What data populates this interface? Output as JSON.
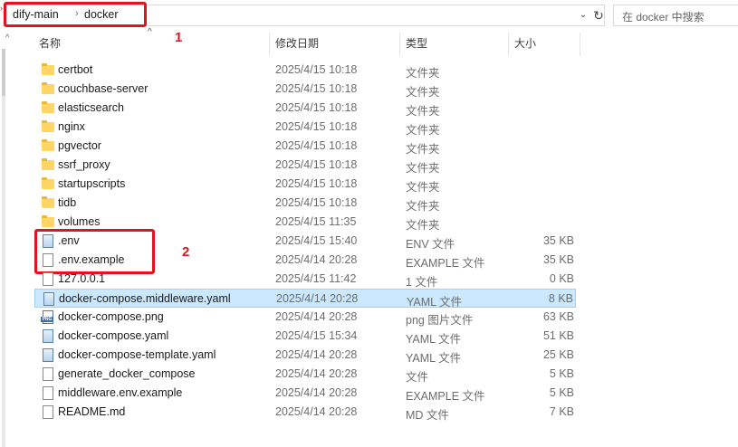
{
  "address": {
    "crumbs": [
      "dify-main",
      "docker"
    ],
    "search_placeholder": "在 docker 中搜索"
  },
  "annotations": {
    "box1_number": "1",
    "box2_number": "2"
  },
  "columns": {
    "name": "名称",
    "date": "修改日期",
    "type": "类型",
    "size": "大小"
  },
  "files": [
    {
      "name": "certbot",
      "date": "2025/4/15 10:18",
      "type": "文件夹",
      "size": "",
      "icon": "folder-icon"
    },
    {
      "name": "couchbase-server",
      "date": "2025/4/15 10:18",
      "type": "文件夹",
      "size": "",
      "icon": "folder-icon"
    },
    {
      "name": "elasticsearch",
      "date": "2025/4/15 10:18",
      "type": "文件夹",
      "size": "",
      "icon": "folder-icon"
    },
    {
      "name": "nginx",
      "date": "2025/4/15 10:18",
      "type": "文件夹",
      "size": "",
      "icon": "folder-icon"
    },
    {
      "name": "pgvector",
      "date": "2025/4/15 10:18",
      "type": "文件夹",
      "size": "",
      "icon": "folder-icon"
    },
    {
      "name": "ssrf_proxy",
      "date": "2025/4/15 10:18",
      "type": "文件夹",
      "size": "",
      "icon": "folder-icon"
    },
    {
      "name": "startupscripts",
      "date": "2025/4/15 10:18",
      "type": "文件夹",
      "size": "",
      "icon": "folder-icon"
    },
    {
      "name": "tidb",
      "date": "2025/4/15 10:18",
      "type": "文件夹",
      "size": "",
      "icon": "folder-icon"
    },
    {
      "name": "volumes",
      "date": "2025/4/15 11:35",
      "type": "文件夹",
      "size": "",
      "icon": "folder-icon"
    },
    {
      "name": ".env",
      "date": "2025/4/15 15:40",
      "type": "ENV 文件",
      "size": "35 KB",
      "icon": "config-file-icon"
    },
    {
      "name": ".env.example",
      "date": "2025/4/14 20:28",
      "type": "EXAMPLE 文件",
      "size": "35 KB",
      "icon": "file-icon"
    },
    {
      "name": "127.0.0.1",
      "date": "2025/4/15 11:42",
      "type": "1 文件",
      "size": "0 KB",
      "icon": "file-icon"
    },
    {
      "name": "docker-compose.middleware.yaml",
      "date": "2025/4/14 20:28",
      "type": "YAML 文件",
      "size": "8 KB",
      "icon": "config-file-icon"
    },
    {
      "name": "docker-compose.png",
      "date": "2025/4/14 20:28",
      "type": "png 图片文件",
      "size": "63 KB",
      "icon": "png-file-icon"
    },
    {
      "name": "docker-compose.yaml",
      "date": "2025/4/15 15:34",
      "type": "YAML 文件",
      "size": "51 KB",
      "icon": "config-file-icon"
    },
    {
      "name": "docker-compose-template.yaml",
      "date": "2025/4/14 20:28",
      "type": "YAML 文件",
      "size": "25 KB",
      "icon": "config-file-icon"
    },
    {
      "name": "generate_docker_compose",
      "date": "2025/4/14 20:28",
      "type": "文件",
      "size": "5 KB",
      "icon": "file-icon"
    },
    {
      "name": "middleware.env.example",
      "date": "2025/4/14 20:28",
      "type": "EXAMPLE 文件",
      "size": "5 KB",
      "icon": "file-icon"
    },
    {
      "name": "README.md",
      "date": "2025/4/14 20:28",
      "type": "MD 文件",
      "size": "7 KB",
      "icon": "file-icon"
    }
  ],
  "selected_file": "docker-compose.middleware.yaml",
  "colors": {
    "annotation": "#e0141e",
    "selection": "#cce8ff",
    "folder": "#ffd666"
  }
}
